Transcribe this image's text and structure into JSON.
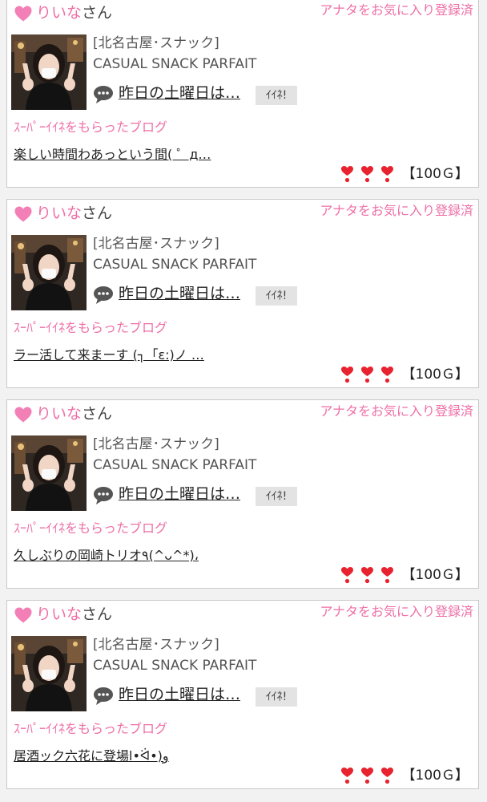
{
  "colors": {
    "accent_pink": "#ee6fa6",
    "heart_red": "#e8232f",
    "card_border": "#c9c9c9",
    "button_gray": "#e3e3e3"
  },
  "icons": {
    "user": "pink-heart-icon",
    "comment": "speech-bubble-icon",
    "rating": "red-heart-exclamation-icon"
  },
  "cards": [
    {
      "user_name": "りいな",
      "honorific": "さん",
      "favorite_status": "アナタをお気に入り登録済",
      "shop_area": "[北名古屋･スナック]",
      "shop_name": "CASUAL SNACK PARFAIT",
      "post_title": "昨日の土曜日は…",
      "like_button": "ｲｲﾈ!",
      "section_label": "ｽｰﾊﾟｰｲｲﾈをもらったブログ",
      "blog_title": "楽しい時間わあっという間( ゜д…",
      "hearts_count": 3,
      "points": "【100Ｇ】"
    },
    {
      "user_name": "りいな",
      "honorific": "さん",
      "favorite_status": "アナタをお気に入り登録済",
      "shop_area": "[北名古屋･スナック]",
      "shop_name": "CASUAL SNACK PARFAIT",
      "post_title": "昨日の土曜日は…",
      "like_button": "ｲｲﾈ!",
      "section_label": "ｽｰﾊﾟｰｲｲﾈをもらったブログ",
      "blog_title": "ラー活して来まーす (┐「ε:)ノ …",
      "hearts_count": 3,
      "points": "【100Ｇ】"
    },
    {
      "user_name": "りいな",
      "honorific": "さん",
      "favorite_status": "アナタをお気に入り登録済",
      "shop_area": "[北名古屋･スナック]",
      "shop_name": "CASUAL SNACK PARFAIT",
      "post_title": "昨日の土曜日は…",
      "like_button": "ｲｲﾈ!",
      "section_label": "ｽｰﾊﾟｰｲｲﾈをもらったブログ",
      "blog_title": "久しぶりの岡崎トリオ٩(^ᴗ^*)،",
      "hearts_count": 3,
      "points": "【100Ｇ】"
    },
    {
      "user_name": "りいな",
      "honorific": "さん",
      "favorite_status": "アナタをお気に入り登録済",
      "shop_area": "[北名古屋･スナック]",
      "shop_name": "CASUAL SNACK PARFAIT",
      "post_title": "昨日の土曜日は…",
      "like_button": "ｲｲﾈ!",
      "section_label": "ｽｰﾊﾟｰｲｲﾈをもらったブログ",
      "blog_title": "居酒ック六花に登場ا•ᐛ•)و",
      "hearts_count": 3,
      "points": "【100Ｇ】"
    }
  ]
}
